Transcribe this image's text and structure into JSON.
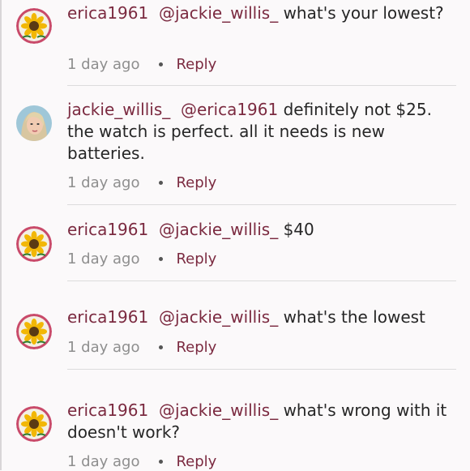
{
  "comments": [
    {
      "username": "erica1961",
      "mention": "@jackie_willis_",
      "text": "what's your lowest?",
      "time": "1 day ago",
      "reply_label": "Reply",
      "avatar": "sunflower-icon"
    },
    {
      "username": "jackie_willis_",
      "mention": "@erica1961",
      "text": "definitely not $25. the watch is perfect. all it needs is new batteries.",
      "time": "1 day ago",
      "reply_label": "Reply",
      "avatar": "user-photo"
    },
    {
      "username": "erica1961",
      "mention": "@jackie_willis_",
      "text": "$40",
      "time": "1 day ago",
      "reply_label": "Reply",
      "avatar": "sunflower-icon"
    },
    {
      "username": "erica1961",
      "mention": "@jackie_willis_",
      "text": "what's the lowest",
      "time": "1 day ago",
      "reply_label": "Reply",
      "avatar": "sunflower-icon"
    },
    {
      "username": "erica1961",
      "mention": "@jackie_willis_",
      "text": "what's wrong with it doesn't work?",
      "time": "1 day ago",
      "reply_label": "Reply",
      "avatar": "sunflower-icon"
    }
  ]
}
